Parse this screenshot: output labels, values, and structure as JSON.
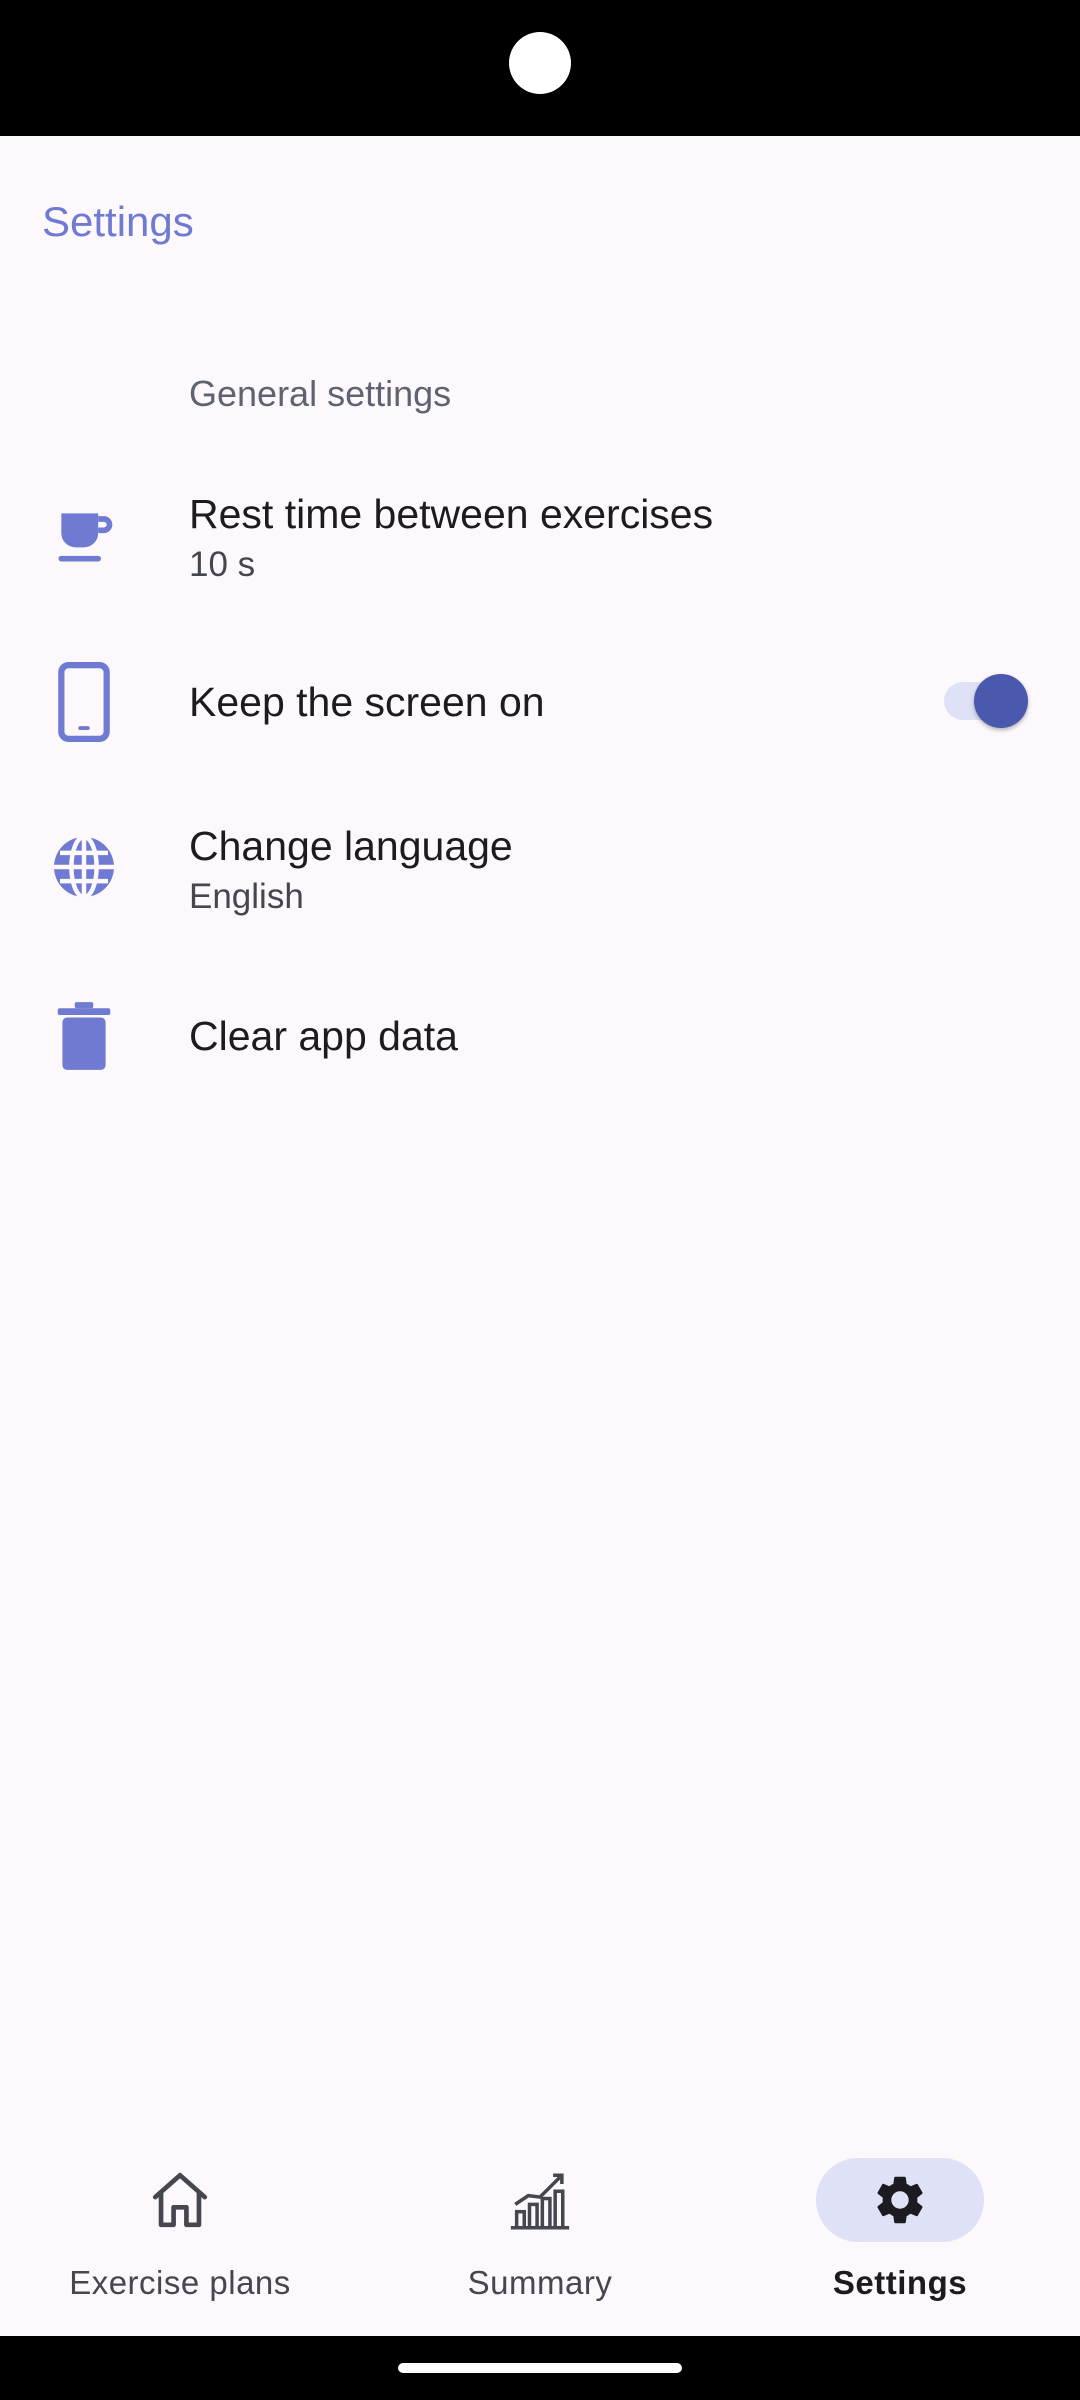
{
  "app": {
    "title": "Settings"
  },
  "settings": {
    "section_header": "General settings",
    "items": [
      {
        "id": "rest-time",
        "icon": "cup-icon",
        "title": "Rest time between exercises",
        "subtitle": "10 s"
      },
      {
        "id": "keep-screen-on",
        "icon": "phone-icon",
        "title": "Keep the screen on",
        "toggle_on": true
      },
      {
        "id": "change-language",
        "icon": "globe-icon",
        "title": "Change language",
        "subtitle": "English"
      },
      {
        "id": "clear-data",
        "icon": "trash-icon",
        "title": "Clear app data"
      }
    ]
  },
  "bottom_nav": {
    "items": [
      {
        "id": "exercise-plans",
        "icon": "home-icon",
        "label": "Exercise plans",
        "active": false
      },
      {
        "id": "summary",
        "icon": "chart-icon",
        "label": "Summary",
        "active": false
      },
      {
        "id": "settings",
        "icon": "gear-icon",
        "label": "Settings",
        "active": true
      }
    ]
  },
  "colors": {
    "accent": "#6f7bd2",
    "toggle_thumb": "#4a58ad",
    "toggle_track": "#dfe1f6",
    "background": "#fcf8fc"
  }
}
